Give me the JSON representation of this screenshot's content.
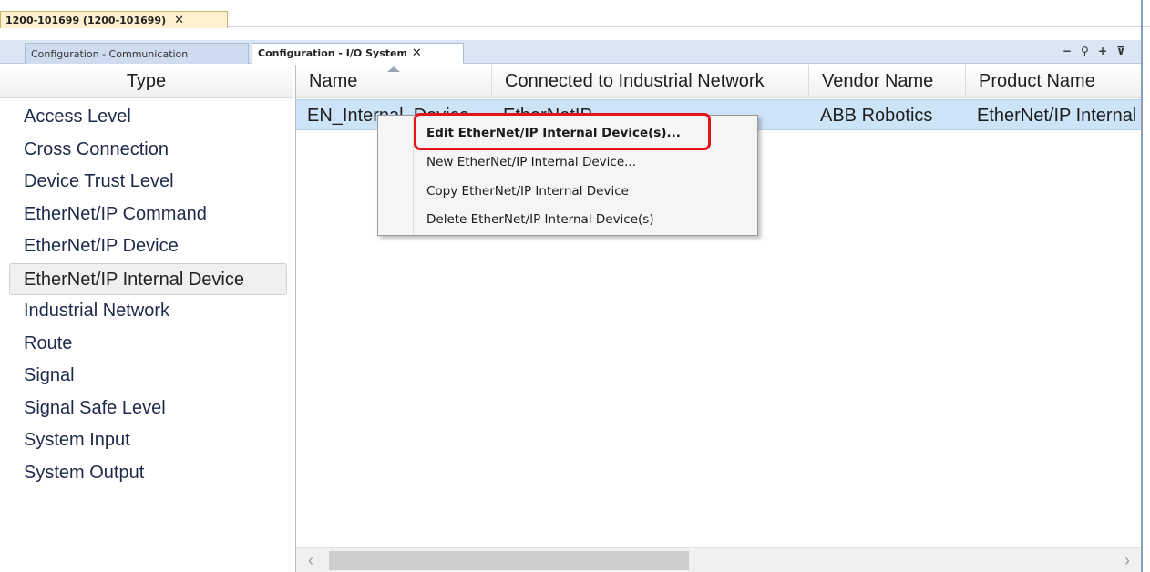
{
  "document_tab": {
    "label": "1200-101699 (1200-101699)",
    "close": "✕"
  },
  "sub_tabs": [
    {
      "label": "Configuration - Communication"
    },
    {
      "label": "Configuration - I/O System",
      "close": "✕"
    }
  ],
  "strip_tools": "− ⚲ + ⊽",
  "type_panel": {
    "header": "Type",
    "items": [
      {
        "label": "Access Level"
      },
      {
        "label": "Cross Connection"
      },
      {
        "label": "Device Trust Level"
      },
      {
        "label": "EtherNet/IP Command"
      },
      {
        "label": "EtherNet/IP Device"
      },
      {
        "label": "EtherNet/IP Internal Device",
        "selected": true
      },
      {
        "label": "Industrial Network"
      },
      {
        "label": "Route"
      },
      {
        "label": "Signal"
      },
      {
        "label": "Signal Safe Level"
      },
      {
        "label": "System Input"
      },
      {
        "label": "System Output"
      }
    ]
  },
  "grid": {
    "columns": [
      "Name",
      "Connected to Industrial Network",
      "Vendor Name",
      "Product Name"
    ],
    "rows": [
      {
        "name": "EN_Internal_Device",
        "network": "EtherNetIP",
        "vendor": "ABB Robotics",
        "product": "EtherNet/IP Internal"
      }
    ]
  },
  "context_menu": {
    "items": [
      {
        "label": "Edit EtherNet/IP Internal Device(s)..."
      },
      {
        "label": "New EtherNet/IP Internal Device..."
      },
      {
        "label": "Copy EtherNet/IP Internal Device"
      },
      {
        "label": "Delete EtherNet/IP Internal Device(s)"
      }
    ]
  },
  "scrollbar": {
    "left_arrow": "‹",
    "right_arrow": "›"
  },
  "colors": {
    "highlight": "#e3171b",
    "selected_row": "#cde3f7",
    "tab_active_doc": "#fdf1cf"
  }
}
